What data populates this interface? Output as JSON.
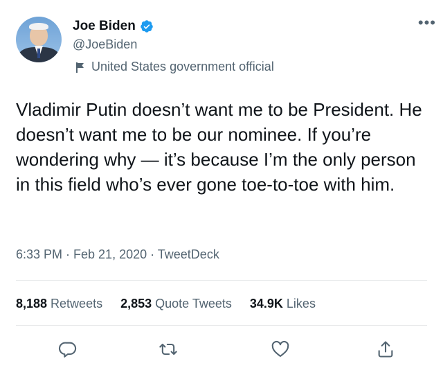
{
  "author": {
    "display_name": "Joe Biden",
    "handle": "@JoeBiden",
    "account_label": "United States government official"
  },
  "tweet": {
    "text": "Vladimir Putin doesn’t want me to be President. He doesn’t want me to be our nominee. If you’re wondering why — it’s because I’m the only person in this field who’s ever gone toe-to-toe with him.",
    "meta": "6:33 PM · Feb 21, 2020 · TweetDeck"
  },
  "stats": {
    "retweets_count": "8,188",
    "retweets_label": "Retweets",
    "quote_count": "2,853",
    "quote_label": "Quote Tweets",
    "likes_count": "34.9K",
    "likes_label": "Likes"
  },
  "icons": {
    "more": "more-icon",
    "verified": "verified-badge-icon",
    "label": "flag-icon",
    "reply": "reply-icon",
    "retweet": "retweet-icon",
    "like": "heart-icon",
    "share": "share-icon"
  },
  "colors": {
    "verified_blue": "#1d9bf0",
    "secondary_text": "#536471",
    "primary_text": "#0f1419"
  }
}
